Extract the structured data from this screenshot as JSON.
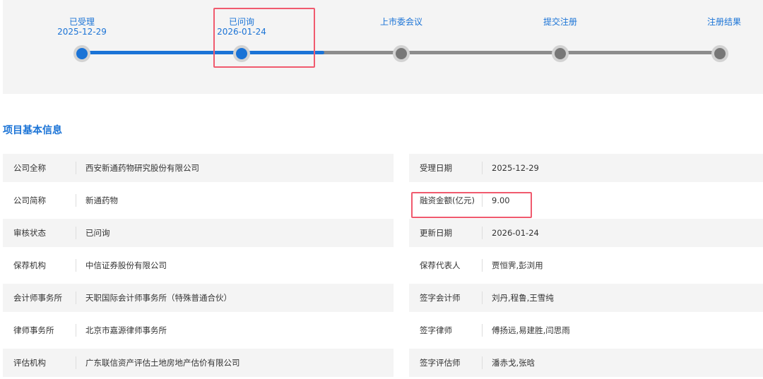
{
  "progress": {
    "fill_fraction": 0.375,
    "steps": [
      {
        "label": "已受理",
        "date": "2025-12-29",
        "done": true
      },
      {
        "label": "已问询",
        "date": "2026-01-24",
        "done": true
      },
      {
        "label": "上市委会议",
        "date": "",
        "done": false
      },
      {
        "label": "提交注册",
        "date": "",
        "done": false
      },
      {
        "label": "注册结果",
        "date": "",
        "done": false
      }
    ]
  },
  "section_title": "项目基本信息",
  "left_rows": [
    {
      "label": "公司全称",
      "value": "西安新通药物研究股份有限公司"
    },
    {
      "label": "公司简称",
      "value": "新通药物"
    },
    {
      "label": "审核状态",
      "value": "已问询"
    },
    {
      "label": "保荐机构",
      "value": "中信证券股份有限公司"
    },
    {
      "label": "会计师事务所",
      "value": "天职国际会计师事务所（特殊普通合伙）"
    },
    {
      "label": "律师事务所",
      "value": "北京市嘉源律师事务所"
    },
    {
      "label": "评估机构",
      "value": "广东联信资产评估土地房地产估价有限公司"
    }
  ],
  "right_rows": [
    {
      "label": "受理日期",
      "value": "2025-12-29"
    },
    {
      "label": "融资金额(亿元)",
      "value": "9.00"
    },
    {
      "label": "更新日期",
      "value": "2026-01-24"
    },
    {
      "label": "保荐代表人",
      "value": "贾恒霁,彭浏用"
    },
    {
      "label": "签字会计师",
      "value": "刘丹,程鲁,王雪纯"
    },
    {
      "label": "签字律师",
      "value": "傅扬远,易建胜,闫思雨"
    },
    {
      "label": "签字评估师",
      "value": "潘赤戈,张晗"
    }
  ],
  "colors": {
    "accent": "#1a73d6",
    "highlight": "#f05a6e",
    "row_shade": "#f4f4f4"
  }
}
